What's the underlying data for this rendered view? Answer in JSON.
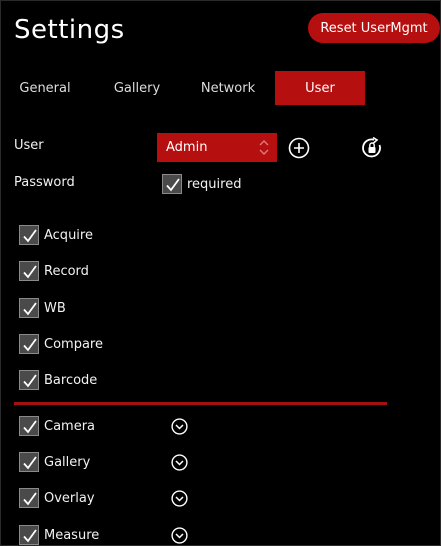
{
  "header": {
    "title": "Settings",
    "reset_label": "Reset UserMgmt"
  },
  "tabs": [
    {
      "label": "General",
      "active": false
    },
    {
      "label": "Gallery",
      "active": false
    },
    {
      "label": "Network",
      "active": false
    },
    {
      "label": "User",
      "active": true
    }
  ],
  "user": {
    "user_label": "User",
    "selected_user": "Admin",
    "password_label": "Password",
    "password_required_label": "required",
    "password_required_checked": true
  },
  "permissions": [
    {
      "label": "Acquire",
      "checked": true
    },
    {
      "label": "Record",
      "checked": true
    },
    {
      "label": "WB",
      "checked": true
    },
    {
      "label": "Compare",
      "checked": true
    },
    {
      "label": "Barcode",
      "checked": true
    }
  ],
  "expandable_permissions": [
    {
      "label": "Camera",
      "checked": true
    },
    {
      "label": "Gallery",
      "checked": true
    },
    {
      "label": "Overlay",
      "checked": true
    },
    {
      "label": "Measure",
      "checked": true
    }
  ],
  "icons": {
    "add_user": "plus-circle-icon",
    "reset_password": "lock-reset-icon",
    "checkbox": "check-icon",
    "expand": "chevron-down-circle-icon"
  },
  "colors": {
    "accent": "#b50f0f",
    "background": "#000000",
    "divider": "#a31212"
  }
}
